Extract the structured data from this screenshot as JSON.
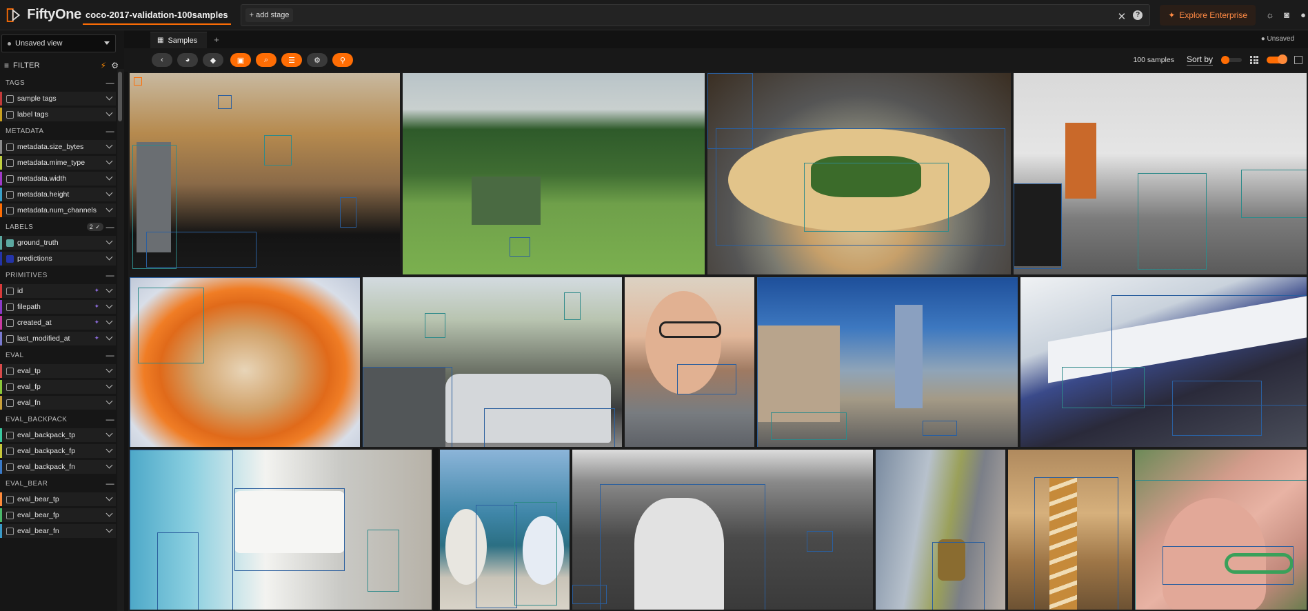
{
  "app": {
    "name": "FiftyOne",
    "dataset": "coco-2017-validation-100samples"
  },
  "topbar": {
    "add_stage": "+ add stage",
    "explore": "Explore Enterprise"
  },
  "sidebar": {
    "view": "Unsaved view",
    "filter_label": "FILTER",
    "sections": [
      {
        "title": "TAGS",
        "fields": [
          "sample tags",
          "label tags"
        ]
      },
      {
        "title": "METADATA",
        "fields": [
          "metadata.size_bytes",
          "metadata.mime_type",
          "metadata.width",
          "metadata.height",
          "metadata.num_channels"
        ]
      },
      {
        "title": "LABELS",
        "count": "2",
        "fields": [
          "ground_truth",
          "predictions"
        ]
      },
      {
        "title": "PRIMITIVES",
        "fields": [
          "id",
          "filepath",
          "created_at",
          "last_modified_at"
        ]
      },
      {
        "title": "EVAL",
        "fields": [
          "eval_tp",
          "eval_fp",
          "eval_fn"
        ]
      },
      {
        "title": "EVAL_BACKPACK",
        "fields": [
          "eval_backpack_tp",
          "eval_backpack_fp",
          "eval_backpack_fn"
        ]
      },
      {
        "title": "EVAL_BEAR",
        "fields": [
          "eval_bear_tp",
          "eval_bear_fp",
          "eval_bear_fn"
        ]
      }
    ],
    "field_colors": [
      "#c23a3a",
      "#c8a020",
      "#8a8a8a",
      "#c0d040",
      "#a03ac8",
      "#3aa0c8",
      "#ff6d04",
      "#5ca8a0",
      "#2434a8",
      "#d83a3a",
      "#8a3ac8",
      "#c83aa0",
      "#7a7ad0",
      "#d84a4a",
      "#8ac83a",
      "#c8a03a",
      "#3ac8a0",
      "#c8c83a",
      "#3a7ac8",
      "#ff8a3a",
      "#4ab86a",
      "#3a9ac8",
      "#9a3ac8"
    ]
  },
  "tabs": [
    {
      "label": "Samples"
    }
  ],
  "unsaved": "Unsaved",
  "toolbar": {
    "samples_count": "100 samples",
    "sort_by": "Sort by"
  }
}
